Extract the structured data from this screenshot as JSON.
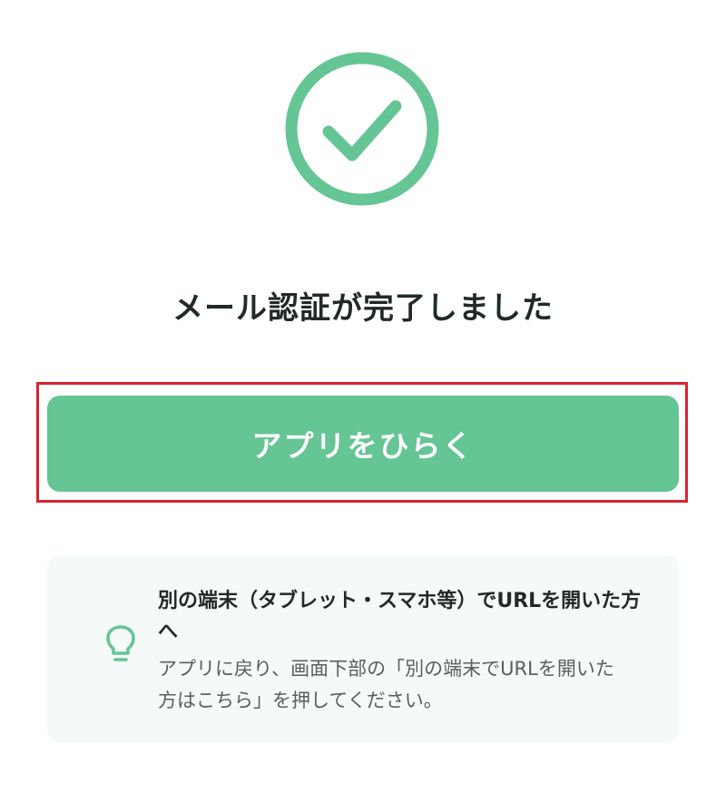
{
  "status_icon": "check-circle-icon",
  "title": "メール認証が完了しました",
  "open_app_button": {
    "label": "アプリをひらく"
  },
  "info": {
    "icon": "lightbulb-icon",
    "heading": "別の端末（タブレット・スマホ等）でURLを開いた方へ",
    "body": "アプリに戻り、画面下部の「別の端末でURLを開いた方はこちら」を押してください。"
  },
  "colors": {
    "accent": "#65c595",
    "highlight_border": "#d8232f",
    "info_bg": "#f5f9f8",
    "text": "#222a28"
  }
}
